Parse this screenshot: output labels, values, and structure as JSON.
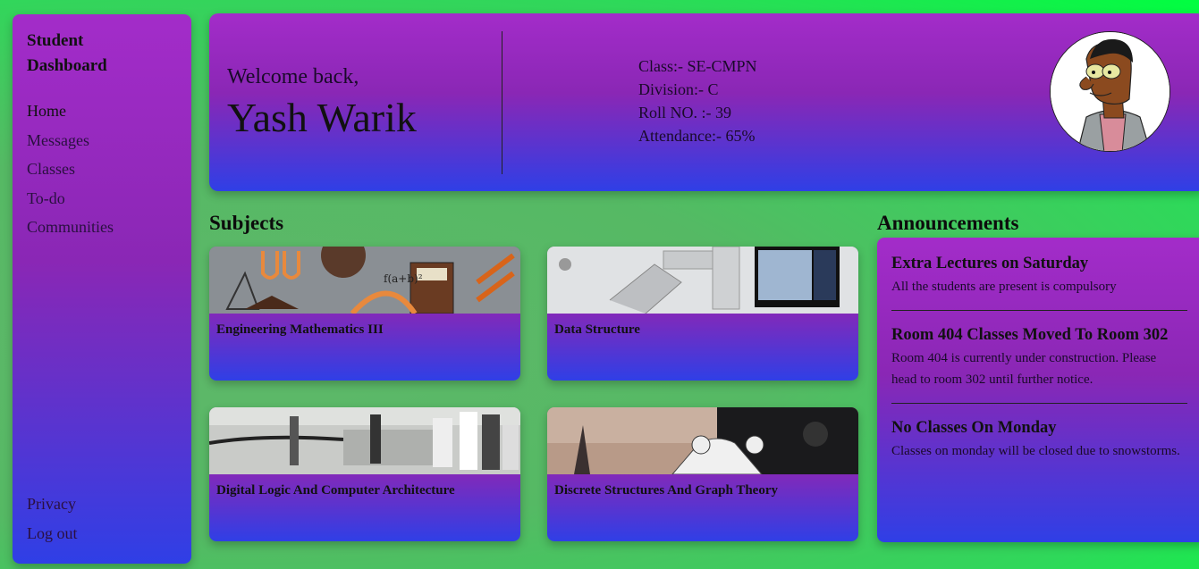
{
  "sidebar": {
    "brand": "Student Dashboard",
    "nav": [
      "Home",
      "Messages",
      "Classes",
      "To-do",
      "Communities"
    ],
    "bottom": [
      "Privacy",
      "Log out"
    ]
  },
  "header": {
    "welcome": "Welcome back,",
    "name": "Yash Warik",
    "info": {
      "class": "Class:- SE-CMPN",
      "division": "Division:- C",
      "roll": "Roll NO. :- 39",
      "attendance": "Attendance:- 65%"
    }
  },
  "subjects": {
    "title": "Subjects",
    "cards": [
      {
        "name": "Engineering Mathematics III"
      },
      {
        "name": "Data Structure"
      },
      {
        "name": "Digital Logic And Computer Architecture"
      },
      {
        "name": "Discrete Structures And Graph Theory"
      }
    ]
  },
  "announcements": {
    "title": "Announcements",
    "items": [
      {
        "title": "Extra Lectures on Saturday",
        "text": "All the students are present is compulsory"
      },
      {
        "title": "Room 404 Classes Moved To Room 302",
        "text": "Room 404 is currently under construction. Please head to room 302 until further notice."
      },
      {
        "title": "No Classes On Monday",
        "text": "Classes on monday will be closed due to snowstorms."
      }
    ]
  },
  "colors": {
    "panel_top": "#a32cc9",
    "panel_bottom": "#2f3fe6",
    "background": "#4fbf63",
    "background_glow": "#00ff40"
  }
}
